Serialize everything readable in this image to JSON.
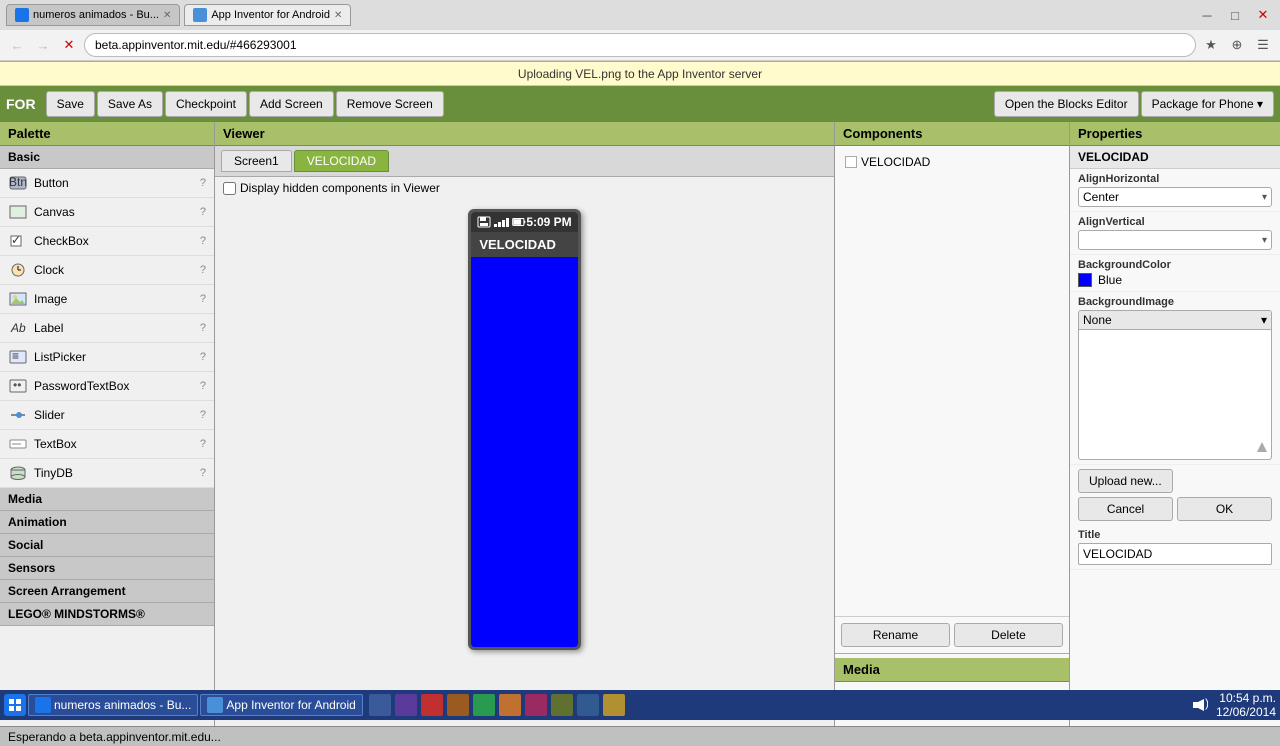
{
  "browser": {
    "tabs": [
      {
        "label": "numeros animados - Bu...",
        "active": false,
        "favicon_color": "#1a73e8"
      },
      {
        "label": "App Inventor for Android",
        "active": true,
        "favicon_color": "#4a90d9"
      }
    ],
    "address": "beta.appinventor.mit.edu/#466293001"
  },
  "banner": {
    "text": "Uploading VEL.png to the App Inventor server"
  },
  "toolbar": {
    "logo": "FOR",
    "buttons": [
      "Save",
      "Save As",
      "Checkpoint",
      "Add Screen",
      "Remove Screen"
    ],
    "right_buttons": [
      "Open the Blocks Editor",
      "Package for Phone ▾"
    ]
  },
  "palette": {
    "title": "Palette",
    "categories": [
      {
        "name": "Basic",
        "items": [
          {
            "label": "Button",
            "icon": "btn"
          },
          {
            "label": "Canvas",
            "icon": "canvas"
          },
          {
            "label": "CheckBox",
            "icon": "checkbox"
          },
          {
            "label": "Clock",
            "icon": "clock"
          },
          {
            "label": "Image",
            "icon": "image"
          },
          {
            "label": "Label",
            "icon": "label"
          },
          {
            "label": "ListPicker",
            "icon": "listpicker"
          },
          {
            "label": "PasswordTextBox",
            "icon": "password"
          },
          {
            "label": "Slider",
            "icon": "slider"
          },
          {
            "label": "TextBox",
            "icon": "textbox"
          },
          {
            "label": "TinyDB",
            "icon": "tinydb"
          }
        ]
      },
      {
        "name": "Media",
        "items": []
      },
      {
        "name": "Animation",
        "items": []
      },
      {
        "name": "Social",
        "items": []
      },
      {
        "name": "Sensors",
        "items": []
      },
      {
        "name": "Screen Arrangement",
        "items": []
      },
      {
        "name": "LEGO® MINDSTORMS®",
        "items": []
      }
    ]
  },
  "viewer": {
    "title": "Viewer",
    "tabs": [
      "Screen1",
      "VELOCIDAD"
    ],
    "active_tab": "VELOCIDAD",
    "checkbox_label": "Display hidden components in Viewer",
    "phone": {
      "time": "5:09 PM",
      "screen_title": "VELOCIDAD",
      "screen_bg": "blue"
    }
  },
  "components": {
    "title": "Components",
    "items": [
      {
        "label": "VELOCIDAD",
        "checked": false
      }
    ],
    "rename_btn": "Rename",
    "delete_btn": "Delete"
  },
  "media": {
    "title": "Media",
    "upload_btn": "Upload new..."
  },
  "properties": {
    "title": "Properties",
    "section_label": "VELOCIDAD",
    "props": [
      {
        "name": "AlignHorizontal",
        "type": "dropdown",
        "value": "Center"
      },
      {
        "name": "AlignVertical",
        "type": "dropdown",
        "value": ""
      },
      {
        "name": "BackgroundColor",
        "type": "color",
        "value": "Blue",
        "color": "#0000ff"
      },
      {
        "name": "BackgroundImage",
        "type": "image-select",
        "value": "None"
      }
    ],
    "upload_new_btn": "Upload new...",
    "cancel_btn": "Cancel",
    "ok_btn": "OK",
    "title_label": "Title",
    "title_value": "VELOCIDAD"
  },
  "status_bar": {
    "text": "Esperando a beta.appinventor.mit.edu..."
  },
  "taskbar": {
    "items": [
      {
        "label": "numeros animados - Bu...",
        "icon_color": "#1a73e8"
      },
      {
        "label": "App Inventor for Android",
        "icon_color": "#4a90d9"
      }
    ],
    "time": "10:54 p.m.",
    "date": "12/06/2014"
  }
}
